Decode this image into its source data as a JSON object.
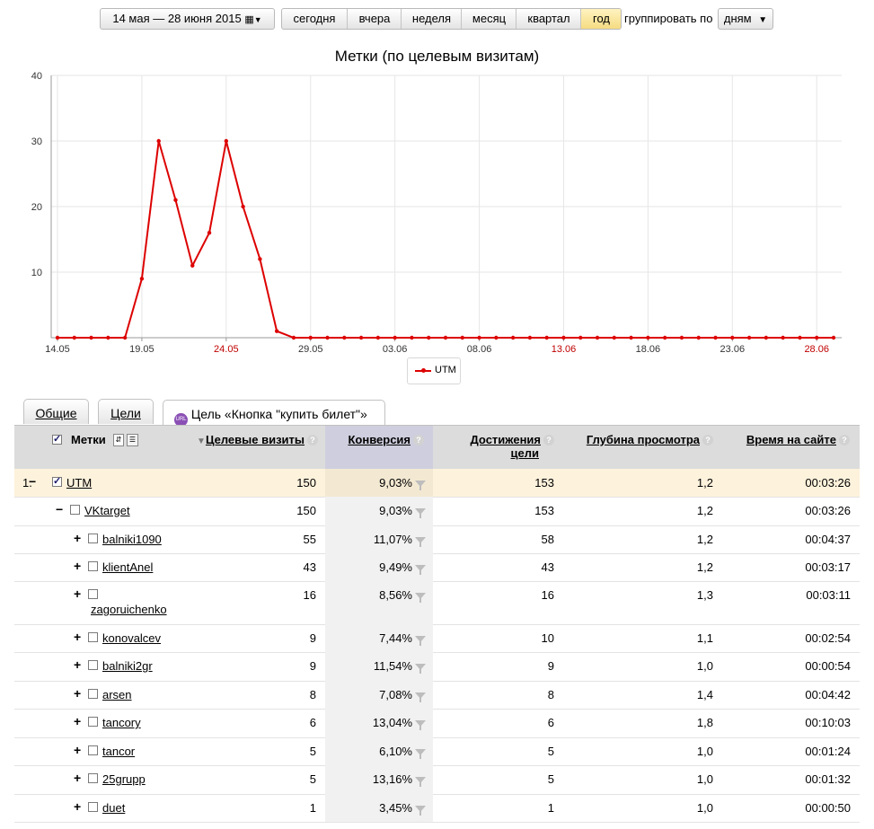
{
  "toolbar": {
    "date_range": "14 мая — 28 июня 2015",
    "periods": [
      "сегодня",
      "вчера",
      "неделя",
      "месяц",
      "квартал",
      "год"
    ],
    "active_period": "год",
    "group_label": "группировать по",
    "group_value": "дням"
  },
  "chart_title": "Метки (по целевым визитам)",
  "chart_data": {
    "type": "line",
    "title": "Метки (по целевым визитам)",
    "xlabel": "",
    "ylabel": "",
    "ylim": [
      0,
      40
    ],
    "yticks": [
      10,
      20,
      30,
      40
    ],
    "x_tick_labels": [
      "14.05",
      "19.05",
      "24.05",
      "29.05",
      "03.06",
      "08.06",
      "13.06",
      "18.06",
      "23.06",
      "28.06"
    ],
    "x_tick_red": [
      "24.05",
      "13.06",
      "28.06"
    ],
    "grid": true,
    "legend_position": "bottom",
    "series": [
      {
        "name": "UTM",
        "color": "#dd0000",
        "values": [
          0,
          0,
          0,
          0,
          0,
          9,
          30,
          21,
          11,
          16,
          30,
          20,
          12,
          1,
          0,
          0,
          0,
          0,
          0,
          0,
          0,
          0,
          0,
          0,
          0,
          0,
          0,
          0,
          0,
          0,
          0,
          0,
          0,
          0,
          0,
          0,
          0,
          0,
          0,
          0,
          0,
          0,
          0,
          0,
          0,
          0,
          0
        ]
      }
    ]
  },
  "tabs": [
    "Общие",
    "Цели",
    "Цель «Кнопка \"купить билет\"»"
  ],
  "table": {
    "headers": {
      "labels": "Метки",
      "visits": "Целевые визиты",
      "conversion": "Конверсия",
      "goal_reached_1": "Достижения",
      "goal_reached_2": "цели",
      "depth": "Глубина просмотра",
      "time": "Время на сайте"
    },
    "rows": [
      {
        "index": "1.",
        "sign": "−",
        "name": "UTM",
        "visits": "150",
        "conv": "9,03%",
        "goals": "153",
        "depth": "1,2",
        "time": "00:03:26"
      },
      {
        "sign": "−",
        "name": "VKtarget",
        "visits": "150",
        "conv": "9,03%",
        "goals": "153",
        "depth": "1,2",
        "time": "00:03:26"
      },
      {
        "sign": "+",
        "name": "balniki1090",
        "visits": "55",
        "conv": "11,07%",
        "goals": "58",
        "depth": "1,2",
        "time": "00:04:37"
      },
      {
        "sign": "+",
        "name": "klientAnel",
        "visits": "43",
        "conv": "9,49%",
        "goals": "43",
        "depth": "1,2",
        "time": "00:03:17"
      },
      {
        "sign": "+",
        "name": "zagoruichenko",
        "visits": "16",
        "conv": "8,56%",
        "goals": "16",
        "depth": "1,3",
        "time": "00:03:11"
      },
      {
        "sign": "+",
        "name": "konovalcev",
        "visits": "9",
        "conv": "7,44%",
        "goals": "10",
        "depth": "1,1",
        "time": "00:02:54"
      },
      {
        "sign": "+",
        "name": "balniki2gr",
        "visits": "9",
        "conv": "11,54%",
        "goals": "9",
        "depth": "1,0",
        "time": "00:00:54"
      },
      {
        "sign": "+",
        "name": "arsen",
        "visits": "8",
        "conv": "7,08%",
        "goals": "8",
        "depth": "1,4",
        "time": "00:04:42"
      },
      {
        "sign": "+",
        "name": "tancory",
        "visits": "6",
        "conv": "13,04%",
        "goals": "6",
        "depth": "1,8",
        "time": "00:10:03"
      },
      {
        "sign": "+",
        "name": "tancor",
        "visits": "5",
        "conv": "6,10%",
        "goals": "5",
        "depth": "1,0",
        "time": "00:01:24"
      },
      {
        "sign": "+",
        "name": "25grupp",
        "visits": "5",
        "conv": "13,16%",
        "goals": "5",
        "depth": "1,0",
        "time": "00:01:32"
      },
      {
        "sign": "+",
        "name": "duet",
        "visits": "1",
        "conv": "3,45%",
        "goals": "1",
        "depth": "1,0",
        "time": "00:00:50"
      }
    ]
  }
}
